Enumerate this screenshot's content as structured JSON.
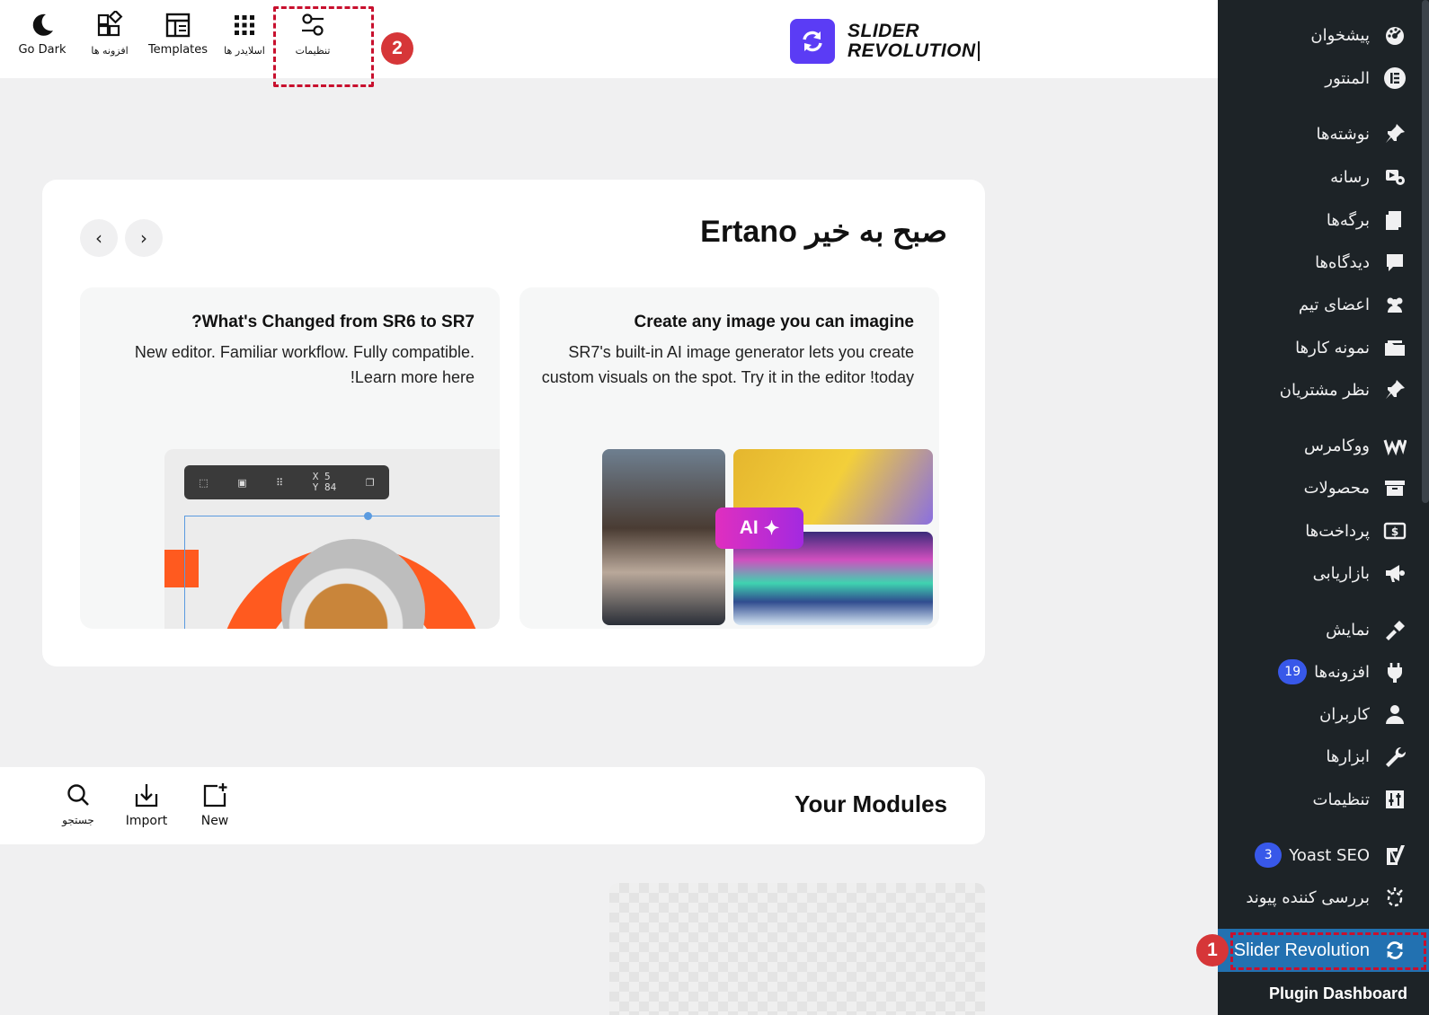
{
  "toolbar": {
    "go_dark": "Go Dark",
    "addons": "افزونه ها",
    "templates": "Templates",
    "sliders": "اسلایدر ها",
    "settings": "تنظیمات"
  },
  "logo": {
    "line1": "SLIDER",
    "line2": "REVOLUTION"
  },
  "annotations": {
    "step1": "1",
    "step2": "2"
  },
  "welcome": {
    "title": "صبح به خیر Ertano",
    "prev_symbol": "‹",
    "next_symbol": "›",
    "card_ai": {
      "title": "Create any image you can imagine",
      "body": "SR7's built-in AI image generator lets you create custom visuals on the spot. Try it in the editor !today",
      "badge": "AI"
    },
    "card_changes": {
      "title": "?What's Changed from SR6 to SR7",
      "body": "New editor. Familiar workflow. Fully compatible. !Learn more here",
      "mock_x": "X",
      "mock_y": "Y",
      "mock_x_val": "5",
      "mock_y_val": "84"
    }
  },
  "modules": {
    "title": "Your Modules",
    "new": "New",
    "import": "Import",
    "search": "جستجو"
  },
  "sidebar": {
    "items": [
      {
        "label": "پیشخوان",
        "icon": "dashboard-icon"
      },
      {
        "label": "المنتور",
        "icon": "elementor-icon"
      },
      {
        "label": "نوشته‌ها",
        "icon": "pin-icon"
      },
      {
        "label": "رسانه",
        "icon": "media-icon"
      },
      {
        "label": "برگه‌ها",
        "icon": "pages-icon"
      },
      {
        "label": "دیدگاه‌ها",
        "icon": "comments-icon"
      },
      {
        "label": "اعضای تیم",
        "icon": "team-icon"
      },
      {
        "label": "نمونه کارها",
        "icon": "portfolio-icon"
      },
      {
        "label": "نظر مشتریان",
        "icon": "pin-icon"
      },
      {
        "label": "ووکامرس",
        "icon": "woocommerce-icon"
      },
      {
        "label": "محصولات",
        "icon": "products-icon"
      },
      {
        "label": "پرداخت‌ها",
        "icon": "payments-icon"
      },
      {
        "label": "بازاریابی",
        "icon": "megaphone-icon"
      },
      {
        "label": "نمایش",
        "icon": "appearance-icon"
      },
      {
        "label": "افزونه‌ها",
        "icon": "plugins-icon",
        "badge": "19"
      },
      {
        "label": "کاربران",
        "icon": "users-icon"
      },
      {
        "label": "ابزارها",
        "icon": "tools-icon"
      },
      {
        "label": "تنظیمات",
        "icon": "settings-icon"
      },
      {
        "label": "Yoast SEO",
        "icon": "yoast-icon",
        "badge": "3"
      },
      {
        "label": "بررسی کننده پیوند",
        "icon": "link-checker-icon"
      }
    ],
    "active_item": "Slider Revolution",
    "submenu_item": "Plugin Dashboard"
  },
  "colors": {
    "admin_bg": "#1d2327",
    "active_blue": "#2271b1",
    "badge_blue": "#3858e9",
    "logo_purple": "#5b3cf5",
    "annotation_red": "#d63638"
  }
}
